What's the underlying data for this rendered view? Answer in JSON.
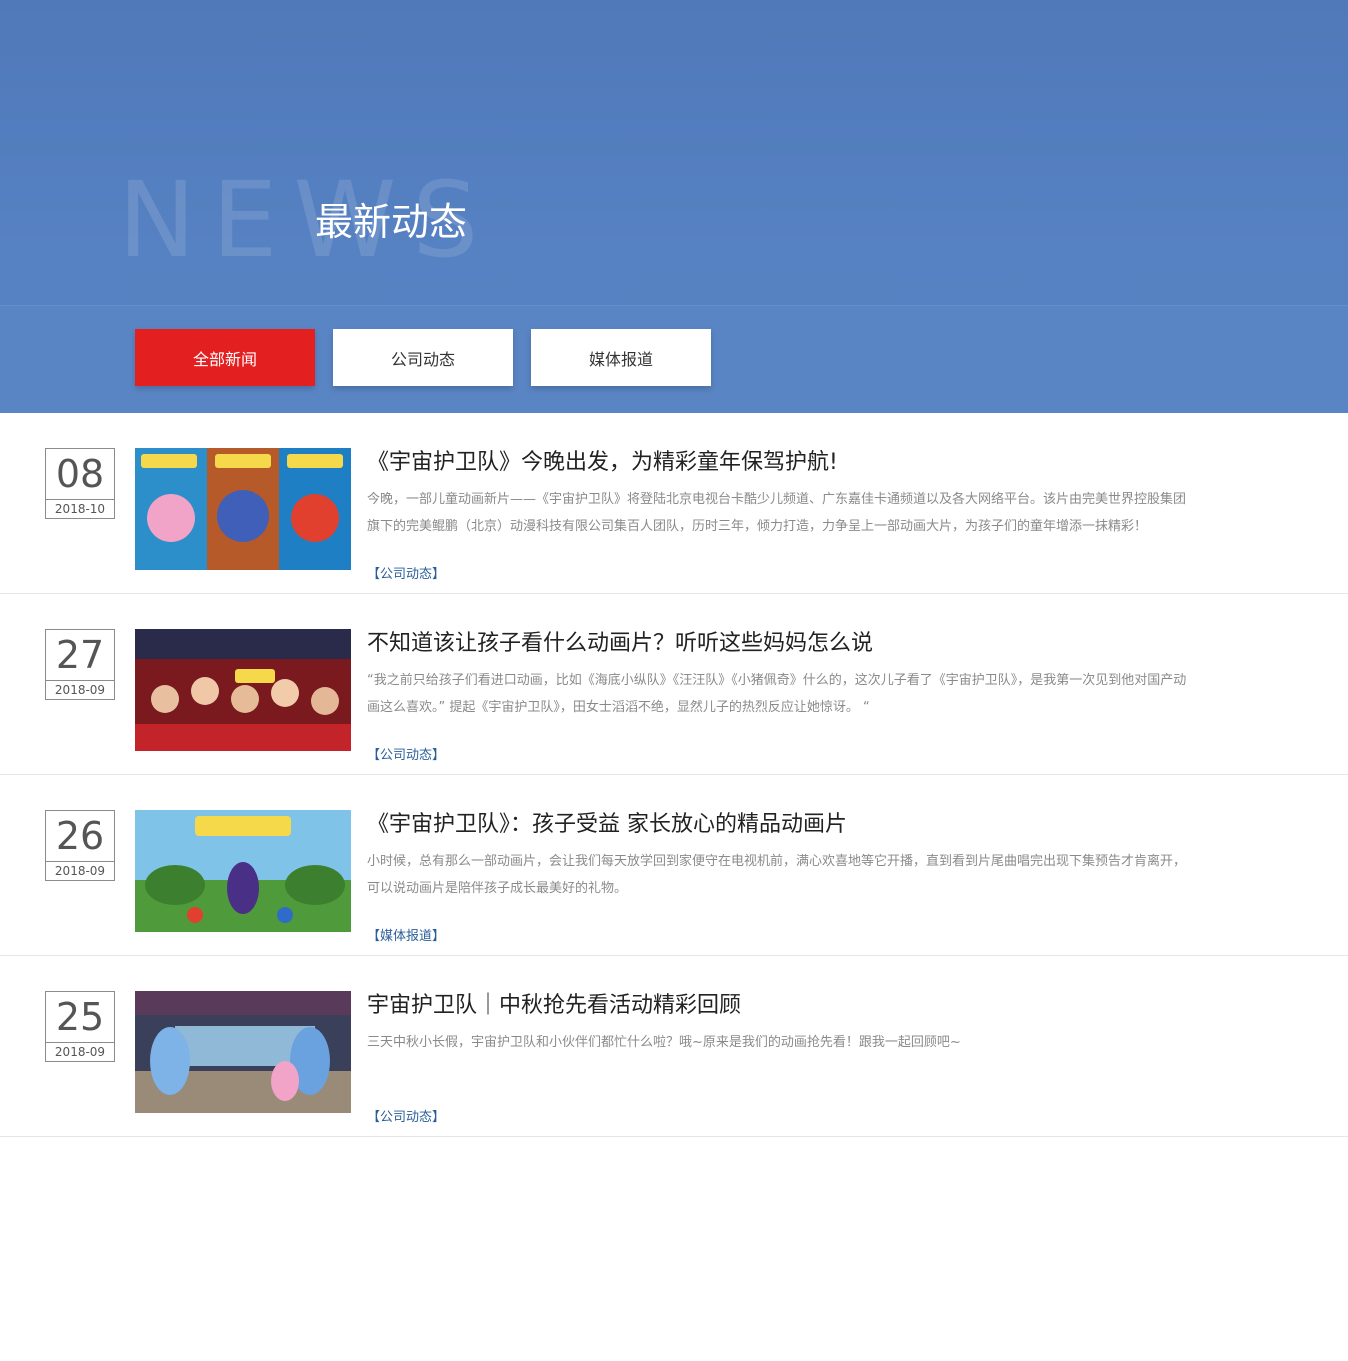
{
  "hero": {
    "watermark": "NEWS",
    "title": "最新动态",
    "tabs": [
      {
        "label": "全部新闻",
        "active": true
      },
      {
        "label": "公司动态",
        "active": false
      },
      {
        "label": "媒体报道",
        "active": false
      }
    ]
  },
  "colors": {
    "hero_bg": "#5681c2",
    "active_tab": "#e41f1f",
    "category_link": "#2a5e9a"
  },
  "news": [
    {
      "day": "08",
      "year_month": "2018-10",
      "title": "《宇宙护卫队》今晚出发，为精彩童年保驾护航!",
      "desc": "今晚，一部儿童动画新片——《宇宙护卫队》将登陆北京电视台卡酷少儿频道、广东嘉佳卡通频道以及各大网络平台。该片由完美世界控股集团旗下的完美鲲鹏（北京）动漫科技有限公司集百人团队，历时三年，倾力打造，力争呈上一部动画大片，为孩子们的童年增添一抹精彩！",
      "category": "【公司动态】"
    },
    {
      "day": "27",
      "year_month": "2018-09",
      "title": "不知道该让孩子看什么动画片？听听这些妈妈怎么说",
      "desc": "“我之前只给孩子们看进口动画，比如《海底小纵队》《汪汪队》《小猪佩奇》什么的，这次儿子看了《宇宙护卫队》，是我第一次见到他对国产动画这么喜欢。” 提起《宇宙护卫队》，田女士滔滔不绝，显然儿子的热烈反应让她惊讶。 “",
      "category": "【公司动态】"
    },
    {
      "day": "26",
      "year_month": "2018-09",
      "title": "《宇宙护卫队》：孩子受益 家长放心的精品动画片",
      "desc": "小时候，总有那么一部动画片，会让我们每天放学回到家便守在电视机前，满心欢喜地等它开播，直到看到片尾曲唱完出现下集预告才肯离开，可以说动画片是陪伴孩子成长最美好的礼物。",
      "category": "【媒体报道】"
    },
    {
      "day": "25",
      "year_month": "2018-09",
      "title": "宇宙护卫队｜中秋抢先看活动精彩回顾",
      "desc": "三天中秋小长假，宇宙护卫队和小伙伴们都忙什么啦？哦~原来是我们的动画抢先看！跟我一起回顾吧~",
      "category": "【公司动态】"
    }
  ]
}
